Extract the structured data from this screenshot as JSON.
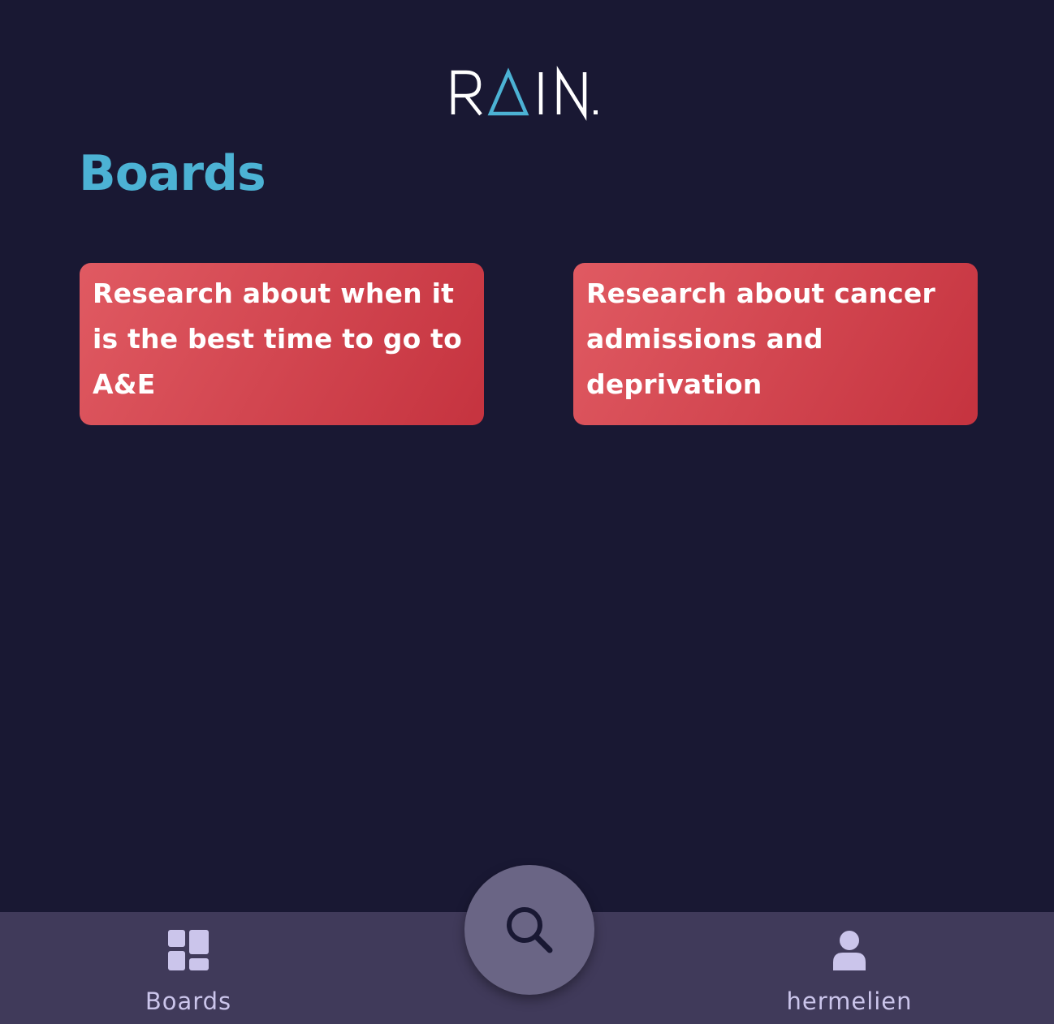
{
  "header": {
    "logo_text": "RAIN.",
    "page_title": "Boards"
  },
  "boards": [
    {
      "title": "Research about when it is the best time to go to A&E"
    },
    {
      "title": "Research about cancer admissions and deprivation"
    }
  ],
  "bottom_nav": {
    "boards_label": "Boards",
    "boards_icon": "dashboard-icon",
    "search_icon": "search-icon",
    "profile_label": "hermelien",
    "profile_icon": "user-icon"
  },
  "colors": {
    "background": "#191833",
    "accent": "#4cb2d4",
    "card_start": "#e05a62",
    "card_end": "#c5333f",
    "nav_bar": "#403a5a",
    "nav_text": "#cbc5eb",
    "fab": "#6a6585"
  }
}
